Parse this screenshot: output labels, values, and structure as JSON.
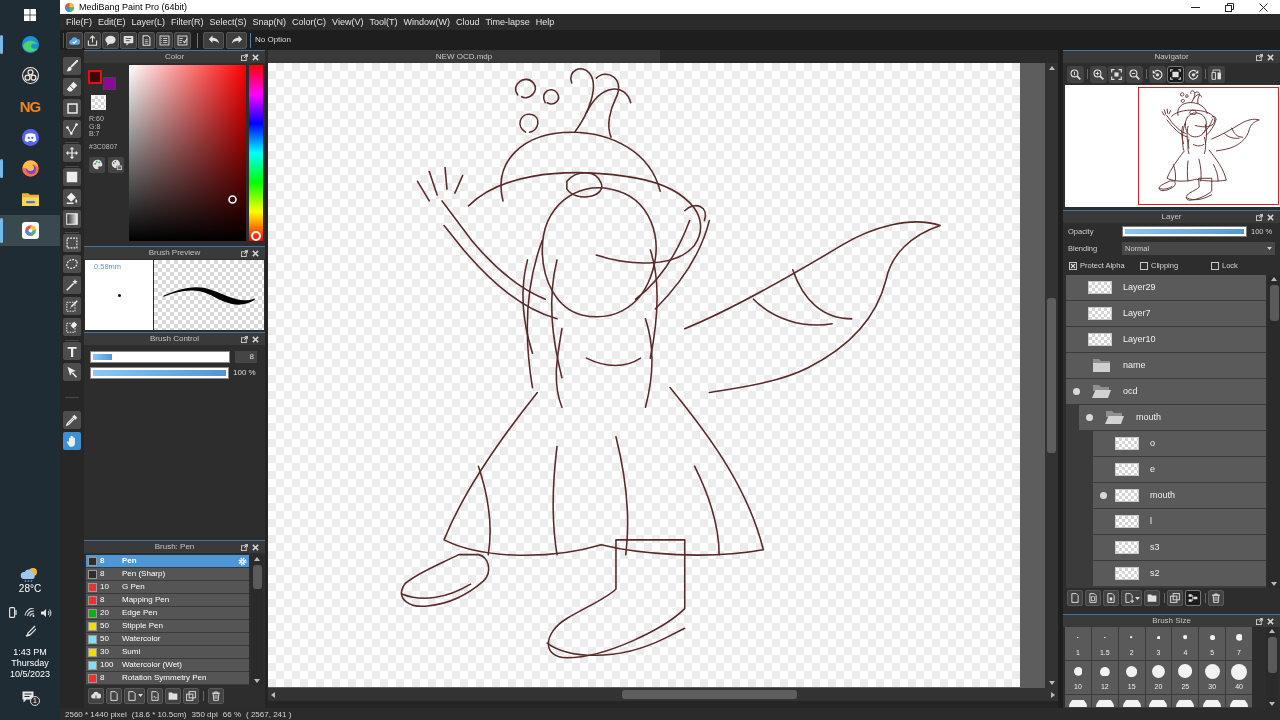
{
  "taskbar": {
    "apps": [
      {
        "kind": "browser",
        "running": true,
        "selected": false
      },
      {
        "kind": "recorder",
        "running": false,
        "selected": false
      },
      {
        "kind": "letters",
        "label": "NG",
        "running": false,
        "selected": false
      },
      {
        "kind": "chat",
        "running": false,
        "selected": false
      },
      {
        "kind": "fox",
        "running": true,
        "selected": false
      },
      {
        "kind": "files",
        "running": false,
        "selected": false
      },
      {
        "kind": "paint",
        "running": true,
        "selected": true
      }
    ],
    "weather": {
      "temperature": "28°C"
    },
    "clock": {
      "time": "1:43 PM",
      "day": "Thursday",
      "date": "10/5/2023"
    },
    "notifications": {
      "count": "1"
    }
  },
  "window": {
    "title": "MediBang Paint Pro (64bit)"
  },
  "menu": [
    "File(F)",
    "Edit(E)",
    "Layer(L)",
    "Filter(R)",
    "Select(S)",
    "Snap(N)",
    "Color(C)",
    "View(V)",
    "Tool(T)",
    "Window(W)",
    "Cloud",
    "Time-lapse",
    "Help"
  ],
  "toolbar": {
    "option": "No Option"
  },
  "tool_groups": [
    [
      {
        "kind": "brush",
        "selected": false
      },
      {
        "kind": "eraser",
        "selected": false
      },
      {
        "kind": "shape",
        "selected": false
      },
      {
        "kind": "polyline",
        "selected": false
      }
    ],
    [
      {
        "kind": "move",
        "selected": false
      }
    ],
    [
      {
        "kind": "fill",
        "selected": false
      },
      {
        "kind": "bucket",
        "selected": false
      },
      {
        "kind": "gradient",
        "selected": false
      }
    ],
    [
      {
        "kind": "select",
        "selected": false
      },
      {
        "kind": "lasso",
        "selected": false
      },
      {
        "kind": "wand",
        "selected": false
      },
      {
        "kind": "selpen",
        "selected": false
      },
      {
        "kind": "selerase",
        "selected": false
      }
    ],
    [
      {
        "kind": "text",
        "glyph": "T",
        "selected": false
      },
      {
        "kind": "operation",
        "selected": false
      }
    ],
    [
      {
        "kind": "eyedropper",
        "selected": false
      },
      {
        "kind": "hand",
        "selected": true
      }
    ]
  ],
  "color_panel": {
    "title": "Color",
    "swatches": [
      {
        "color": "#3c0807",
        "selected": true
      },
      {
        "color": "#8a0b96",
        "selected": false
      }
    ],
    "readings": [
      "R:60",
      "G:8",
      "B:7"
    ],
    "hex": "#3C0807",
    "hue_slider": {
      "level": 0
    }
  },
  "brush_preview": {
    "title": "Brush Preview",
    "size": "0.58mm"
  },
  "brush_control": {
    "title": "Brush Control",
    "sliders": [
      {
        "kind": "boxed",
        "level": 0.14,
        "reading": "8"
      },
      {
        "kind": "plain",
        "level": 1,
        "reading": "100 %"
      }
    ]
  },
  "brush_list": {
    "title": "Brush: Pen",
    "items": [
      {
        "color": "#2e2e2e",
        "size": "8",
        "name": "Pen",
        "selected": true
      },
      {
        "color": "#2e2e2e",
        "size": "8",
        "name": "Pen (Sharp)",
        "selected": false
      },
      {
        "color": "#f03030",
        "size": "10",
        "name": "G Pen",
        "selected": false
      },
      {
        "color": "#f03030",
        "size": "8",
        "name": "Mapping Pen",
        "selected": false
      },
      {
        "color": "#10b010",
        "size": "20",
        "name": "Edge Pen",
        "selected": false
      },
      {
        "color": "#eedd10",
        "size": "50",
        "name": "Stipple Pen",
        "selected": false
      },
      {
        "color": "#80e0f8",
        "size": "50",
        "name": "Watercolor",
        "selected": false
      },
      {
        "color": "#eedd10",
        "size": "30",
        "name": "Sumi",
        "selected": false
      },
      {
        "color": "#80e0f8",
        "size": "100",
        "name": "Watercolor (Wet)",
        "selected": false
      },
      {
        "color": "#f03030",
        "size": "8",
        "name": "Rotation Symmetry Pen",
        "selected": false
      }
    ]
  },
  "canvas": {
    "tab": "NEW OCD.mdp"
  },
  "navigator": {
    "title": "Navigator",
    "button_groups": [
      [
        {
          "kind": "zoomreset",
          "on": false
        }
      ],
      [
        {
          "kind": "zoomin",
          "on": false
        },
        {
          "kind": "fit",
          "on": false
        },
        {
          "kind": "zoomout",
          "on": false
        }
      ],
      [
        {
          "kind": "rotleft",
          "on": false
        },
        {
          "kind": "fitscreen",
          "on": true
        },
        {
          "kind": "rotright",
          "on": false
        }
      ],
      [
        {
          "kind": "flip",
          "on": false
        }
      ]
    ]
  },
  "layer_panel": {
    "title": "Layer",
    "opacity": {
      "label": "Opacity",
      "level": 1,
      "reading": "100 %"
    },
    "blending": {
      "label": "Blending",
      "value": "Normal"
    },
    "options": [
      {
        "label": "Protect Alpha",
        "checked": true
      },
      {
        "label": "Clipping",
        "checked": false
      },
      {
        "label": "Lock",
        "checked": false
      }
    ],
    "layers": [
      {
        "kind": "layer",
        "name": "Layer29",
        "visible": false
      },
      {
        "kind": "layer",
        "name": "Layer7",
        "visible": false
      },
      {
        "kind": "layer",
        "name": "Layer10",
        "visible": false
      },
      {
        "kind": "folder",
        "name": "name",
        "visible": false,
        "expanded": false
      },
      {
        "kind": "folder",
        "name": "ocd",
        "visible": true,
        "expanded": true,
        "children": [
          {
            "kind": "folder",
            "name": "mouth",
            "visible": true,
            "expanded": true,
            "children": [
              {
                "kind": "layer",
                "name": "o",
                "visible": false
              },
              {
                "kind": "layer",
                "name": "e",
                "visible": false
              },
              {
                "kind": "layer",
                "name": "mouth",
                "visible": true
              },
              {
                "kind": "layer",
                "name": "l",
                "visible": false
              },
              {
                "kind": "layer",
                "name": "s3",
                "visible": false
              },
              {
                "kind": "layer",
                "name": "s2",
                "visible": false
              }
            ]
          }
        ]
      }
    ],
    "button_groups": [
      [
        {
          "kind": "new",
          "on": false
        },
        {
          "kind": "newtone",
          "on": false
        },
        {
          "kind": "newbit",
          "on": false
        },
        {
          "kind": "adddrop",
          "on": false
        },
        {
          "kind": "folder",
          "on": false
        }
      ],
      [
        {
          "kind": "copy",
          "on": false
        },
        {
          "kind": "merge",
          "on": true
        }
      ],
      [
        {
          "kind": "trash",
          "on": false
        }
      ]
    ]
  },
  "brush_size": {
    "title": "Brush Size",
    "sizes": [
      "1",
      "1.5",
      "2",
      "3",
      "4",
      "5",
      "7",
      "10",
      "12",
      "15",
      "20",
      "25",
      "30",
      "40"
    ]
  },
  "status_bar": [
    "2560 * 1440 pixel",
    "(18.6 * 10.5cm)",
    "350 dpi",
    "66 %",
    "( 2567, 241 )"
  ]
}
